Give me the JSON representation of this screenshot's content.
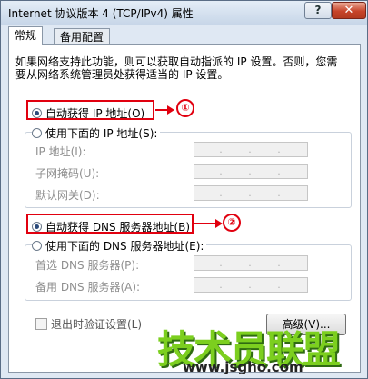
{
  "window": {
    "title": "Internet 协议版本 4 (TCP/IPv4) 属性",
    "help_label": "?",
    "close_label": "✕"
  },
  "tabs": [
    {
      "label": "常规"
    },
    {
      "label": "备用配置"
    }
  ],
  "description": "如果网络支持此功能，则可以获取自动指派的 IP 设置。否则，您需要从网络系统管理员处获得适当的 IP 设置。",
  "ip_section": {
    "auto_option": "自动获得 IP 地址(O)",
    "manual_option": "使用下面的 IP 地址(S):",
    "fields": [
      {
        "label": "IP 地址(I):"
      },
      {
        "label": "子网掩码(U):"
      },
      {
        "label": "默认网关(D):"
      }
    ]
  },
  "dns_section": {
    "auto_option": "自动获得 DNS 服务器地址(B)",
    "manual_option": "使用下面的 DNS 服务器地址(E):",
    "fields": [
      {
        "label": "首选 DNS 服务器(P):"
      },
      {
        "label": "备用 DNS 服务器(A):"
      }
    ]
  },
  "validate_checkbox": "退出时验证设置(L)",
  "advanced_button": "高级(V)...",
  "annotations": {
    "marker_1": "①",
    "marker_2": "②",
    "color": "#e1000f"
  },
  "watermark": {
    "brand": "技术员联盟",
    "url": "www.jsgho.com"
  }
}
